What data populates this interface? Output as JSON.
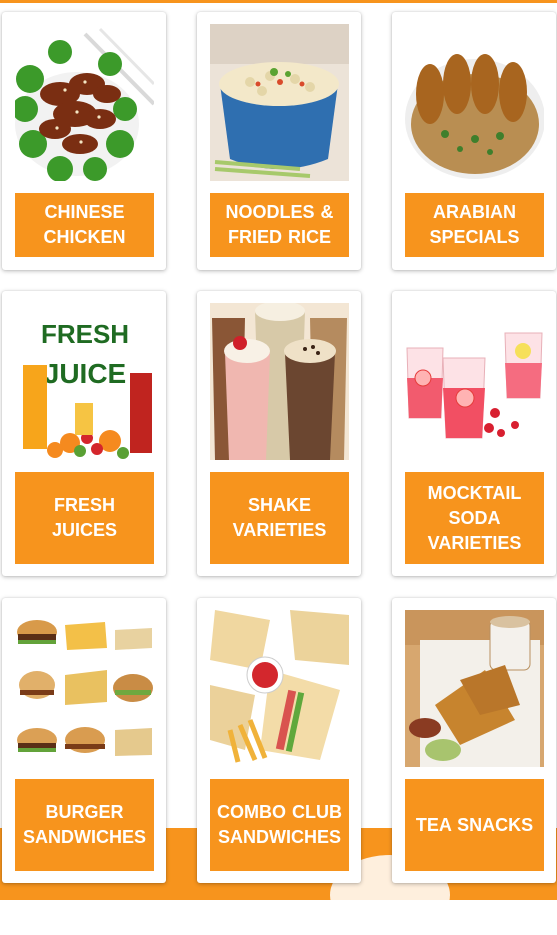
{
  "colors": {
    "accent": "#f7941d",
    "card_bg": "#ffffff",
    "label_text": "#ffffff"
  },
  "menu": {
    "categories": [
      {
        "label": "CHINESE\nCHICKEN",
        "image": "chinese-chicken-image"
      },
      {
        "label": "NOODLES &\nFRIED RICE",
        "image": "noodles-fried-rice-image"
      },
      {
        "label": "ARABIAN\nSPECIALS",
        "image": "arabian-specials-image"
      },
      {
        "label": "FRESH\nJUICES",
        "image": "fresh-juice-image",
        "image_text_1": "FRESH",
        "image_text_2": "JUICE"
      },
      {
        "label": "SHAKE\nVARIETIES",
        "image": "shakes-image"
      },
      {
        "label": "MOCKTAIL\nSODA\nVARIETIES",
        "image": "mocktail-soda-image"
      },
      {
        "label": "BURGER\nSANDWICHES",
        "image": "burger-sandwiches-image"
      },
      {
        "label": "COMBO  CLUB\nSANDWICHES",
        "image": "club-sandwiches-image"
      },
      {
        "label": "TEA  SNACKS",
        "image": "tea-snacks-image"
      }
    ]
  }
}
